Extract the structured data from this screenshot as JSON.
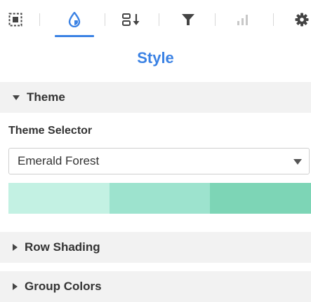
{
  "toolbar": {
    "icons": [
      "select-frame-icon",
      "droplet-icon",
      "sort-icon",
      "filter-icon",
      "bar-chart-icon",
      "gear-icon"
    ],
    "active_tab": "droplet-icon"
  },
  "colors": {
    "accent": "#3b82e4",
    "section_bg": "#f2f2f2",
    "disabled": "#c8c8c8"
  },
  "panel": {
    "title": "Style"
  },
  "sections": {
    "theme": {
      "label": "Theme",
      "expanded": true,
      "selector_label": "Theme Selector",
      "selected_theme": "Emerald Forest",
      "swatches": [
        "#c3f1e3",
        "#9de3ce",
        "#7dd5b6"
      ]
    },
    "row_shading": {
      "label": "Row Shading",
      "expanded": false
    },
    "group_colors": {
      "label": "Group Colors",
      "expanded": false
    }
  }
}
